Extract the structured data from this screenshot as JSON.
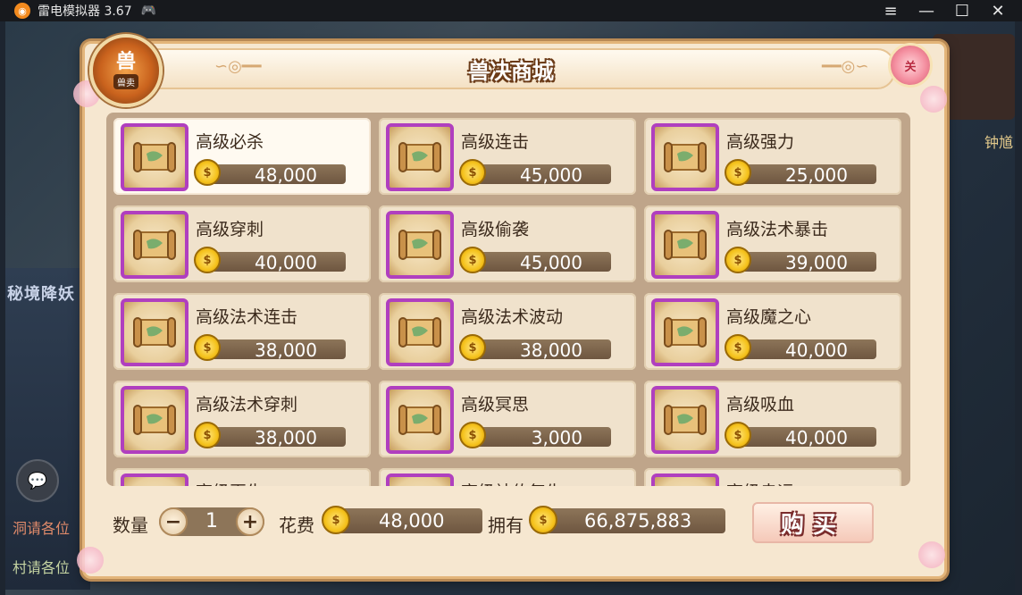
{
  "window": {
    "title": "雷电模拟器 3.67",
    "controls": [
      "≡",
      "—",
      "☐",
      "✕"
    ]
  },
  "background": {
    "left_banner": "秘境降妖",
    "chat_line1": "洞请各位",
    "chat_line2": "村请各位",
    "right_label": "钟馗"
  },
  "badge": {
    "glyph": "兽",
    "label": "兽卖"
  },
  "panel": {
    "title": "兽决商城",
    "close_label": "关"
  },
  "items": [
    {
      "name": "高级必杀",
      "price": "48,000",
      "selected": true
    },
    {
      "name": "高级连击",
      "price": "45,000"
    },
    {
      "name": "高级强力",
      "price": "25,000"
    },
    {
      "name": "高级穿刺",
      "price": "40,000"
    },
    {
      "name": "高级偷袭",
      "price": "45,000"
    },
    {
      "name": "高级法术暴击",
      "price": "39,000"
    },
    {
      "name": "高级法术连击",
      "price": "38,000"
    },
    {
      "name": "高级法术波动",
      "price": "38,000"
    },
    {
      "name": "高级魔之心",
      "price": "40,000"
    },
    {
      "name": "高级法术穿刺",
      "price": "38,000"
    },
    {
      "name": "高级冥思",
      "price": "3,000"
    },
    {
      "name": "高级吸血",
      "price": "40,000"
    },
    {
      "name": "高级再生",
      "price": ""
    },
    {
      "name": "高级神佑复生",
      "price": ""
    },
    {
      "name": "高级幸运",
      "price": ""
    }
  ],
  "purchase": {
    "qty_label": "数量",
    "qty_value": "1",
    "cost_label": "花费",
    "cost_value": "48,000",
    "own_label": "拥有",
    "own_value": "66,875,883",
    "buy_label": "购买"
  },
  "colors": {
    "accent_frame": "#b03fbf",
    "price_bar": "#8d7559",
    "coin": "#f5c21c"
  }
}
